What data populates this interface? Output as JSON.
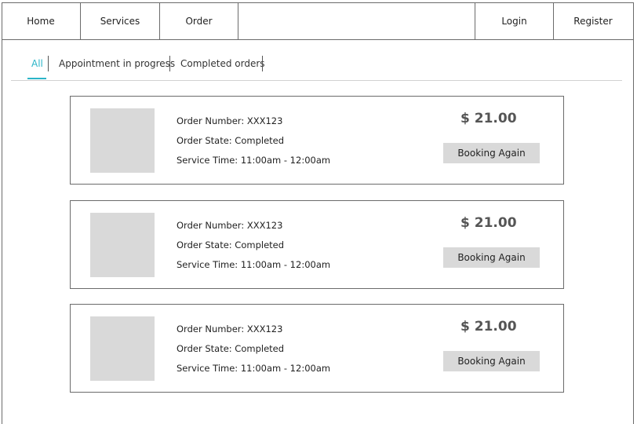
{
  "nav": {
    "home": "Home",
    "services": "Services",
    "order": "Order",
    "login": "Login",
    "register": "Register"
  },
  "tabs": {
    "all": "All",
    "in_progress": "Appointment in progress",
    "completed": "Completed orders"
  },
  "colors": {
    "accent": "#2bb5c8",
    "placeholder": "#d9d9d9"
  },
  "orders": [
    {
      "number": "Order Number: XXX123",
      "state": "Order State: Completed",
      "time": "Service Time: 11:00am - 12:00am",
      "price": "$ 21.00",
      "button": "Booking Again"
    },
    {
      "number": "Order Number: XXX123",
      "state": "Order State: Completed",
      "time": "Service Time: 11:00am - 12:00am",
      "price": "$ 21.00",
      "button": "Booking Again"
    },
    {
      "number": "Order Number: XXX123",
      "state": "Order State: Completed",
      "time": "Service Time: 11:00am - 12:00am",
      "price": "$ 21.00",
      "button": "Booking Again"
    }
  ]
}
